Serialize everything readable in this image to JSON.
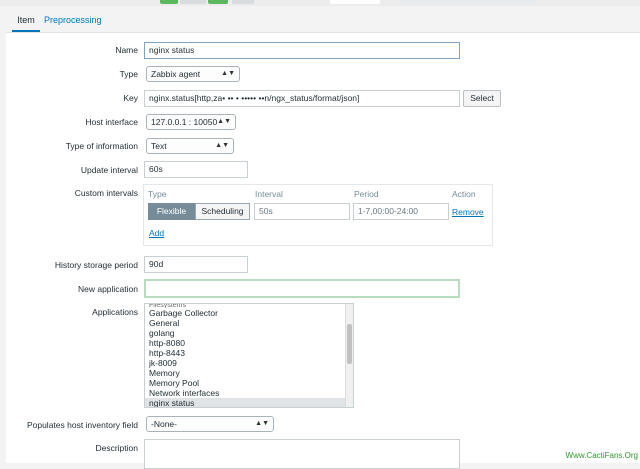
{
  "tabs": [
    {
      "label": "Item"
    },
    {
      "label": "Preprocessing"
    }
  ],
  "form": {
    "name": {
      "label": "Name",
      "value": "nginx status"
    },
    "type": {
      "label": "Type",
      "value": "Zabbix agent"
    },
    "key": {
      "label": "Key",
      "value": "nginx.status[http,za• •• • ••••• ••n/ngx_status/format/json]",
      "select_label": "Select"
    },
    "host_interface": {
      "label": "Host interface",
      "value": "127.0.0.1 : 10050"
    },
    "type_of_information": {
      "label": "Type of information",
      "value": "Text"
    },
    "update_interval": {
      "label": "Update interval",
      "value": "60s"
    },
    "custom_intervals": {
      "label": "Custom intervals",
      "headers": {
        "type": "Type",
        "interval": "Interval",
        "period": "Period",
        "action": "Action"
      },
      "row": {
        "flexible": "Flexible",
        "scheduling": "Scheduling",
        "interval": "50s",
        "period": "1-7,00:00-24:00",
        "remove": "Remove"
      },
      "add": "Add"
    },
    "history_storage_period": {
      "label": "History storage period",
      "value": "90d"
    },
    "new_application": {
      "label": "New application",
      "value": ""
    },
    "applications": {
      "label": "Applications",
      "partial_top": "Filesystems",
      "items": [
        "Garbage Collector",
        "General",
        "golang",
        "http-8080",
        "http-8443",
        "jk-8009",
        "Memory",
        "Memory Pool",
        "Network interfaces",
        "nginx status"
      ],
      "selected": "nginx status"
    },
    "populates_host_inventory_field": {
      "label": "Populates host inventory field",
      "value": "-None-"
    },
    "description": {
      "label": "Description",
      "value": ""
    }
  },
  "watermark": "Www.CactiFans.Org",
  "colors": {
    "accent": "#0275b8",
    "segment_on": "#768d99",
    "top_green": "#5cb85c"
  }
}
